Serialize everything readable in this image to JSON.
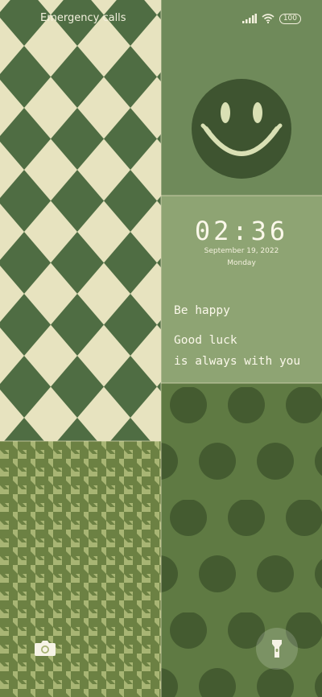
{
  "status_bar": {
    "carrier_text": "Emergency calls",
    "battery_level": "100",
    "icons": [
      "signal-icon",
      "wifi-icon",
      "battery-icon"
    ]
  },
  "clock": {
    "time": "02:36",
    "date": "September 19, 2022",
    "day": "Monday"
  },
  "notes": {
    "line1": "Be happy",
    "line2": "Good luck",
    "line3": "is always with you"
  },
  "shortcuts": {
    "left": "camera-icon",
    "right": "flashlight-icon"
  },
  "colors": {
    "checker_dark": "#4f6d43",
    "checker_light": "#e7e3bf",
    "smiley_face": "#3e5430",
    "smiley_features": "#d9e0b4",
    "dots": "#445b30",
    "houndstooth_light": "#a8b574",
    "houndstooth_dark": "#6c8143"
  }
}
